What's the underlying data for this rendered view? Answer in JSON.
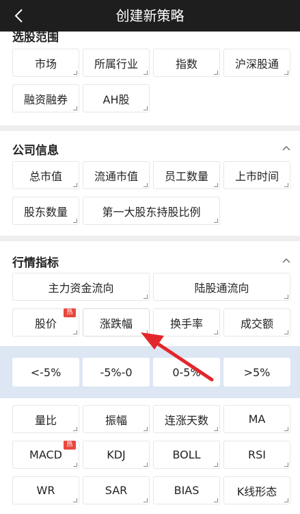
{
  "header": {
    "title": "创建新策略"
  },
  "sections": {
    "stock_range": {
      "title": "选股范围",
      "items": [
        "市场",
        "所属行业",
        "指数",
        "沪深股通",
        "融资融券",
        "AH股"
      ]
    },
    "company": {
      "title": "公司信息",
      "items": [
        "总市值",
        "流通市值",
        "员工数量",
        "上市时间",
        "股东数量",
        "第一大股东持股比例"
      ]
    },
    "market": {
      "title": "行情指标",
      "row1": [
        "主力资金流向",
        "陆股通流向"
      ],
      "row2": [
        "股价",
        "涨跌幅",
        "换手率",
        "成交额"
      ],
      "sub_options": [
        "<-5%",
        "-5%-0",
        "0-5%",
        ">5%"
      ],
      "indicators": [
        "量比",
        "振幅",
        "连涨天数",
        "MA",
        "MACD",
        "KDJ",
        "BOLL",
        "RSI",
        "WR",
        "SAR",
        "BIAS",
        "K线形态"
      ]
    }
  },
  "hot_badge": "热",
  "colors": {
    "header_bg": "#1e1e1e",
    "hot": "#e8483e",
    "arrow": "#e3262b",
    "sub_bg": "#dde6f3"
  }
}
